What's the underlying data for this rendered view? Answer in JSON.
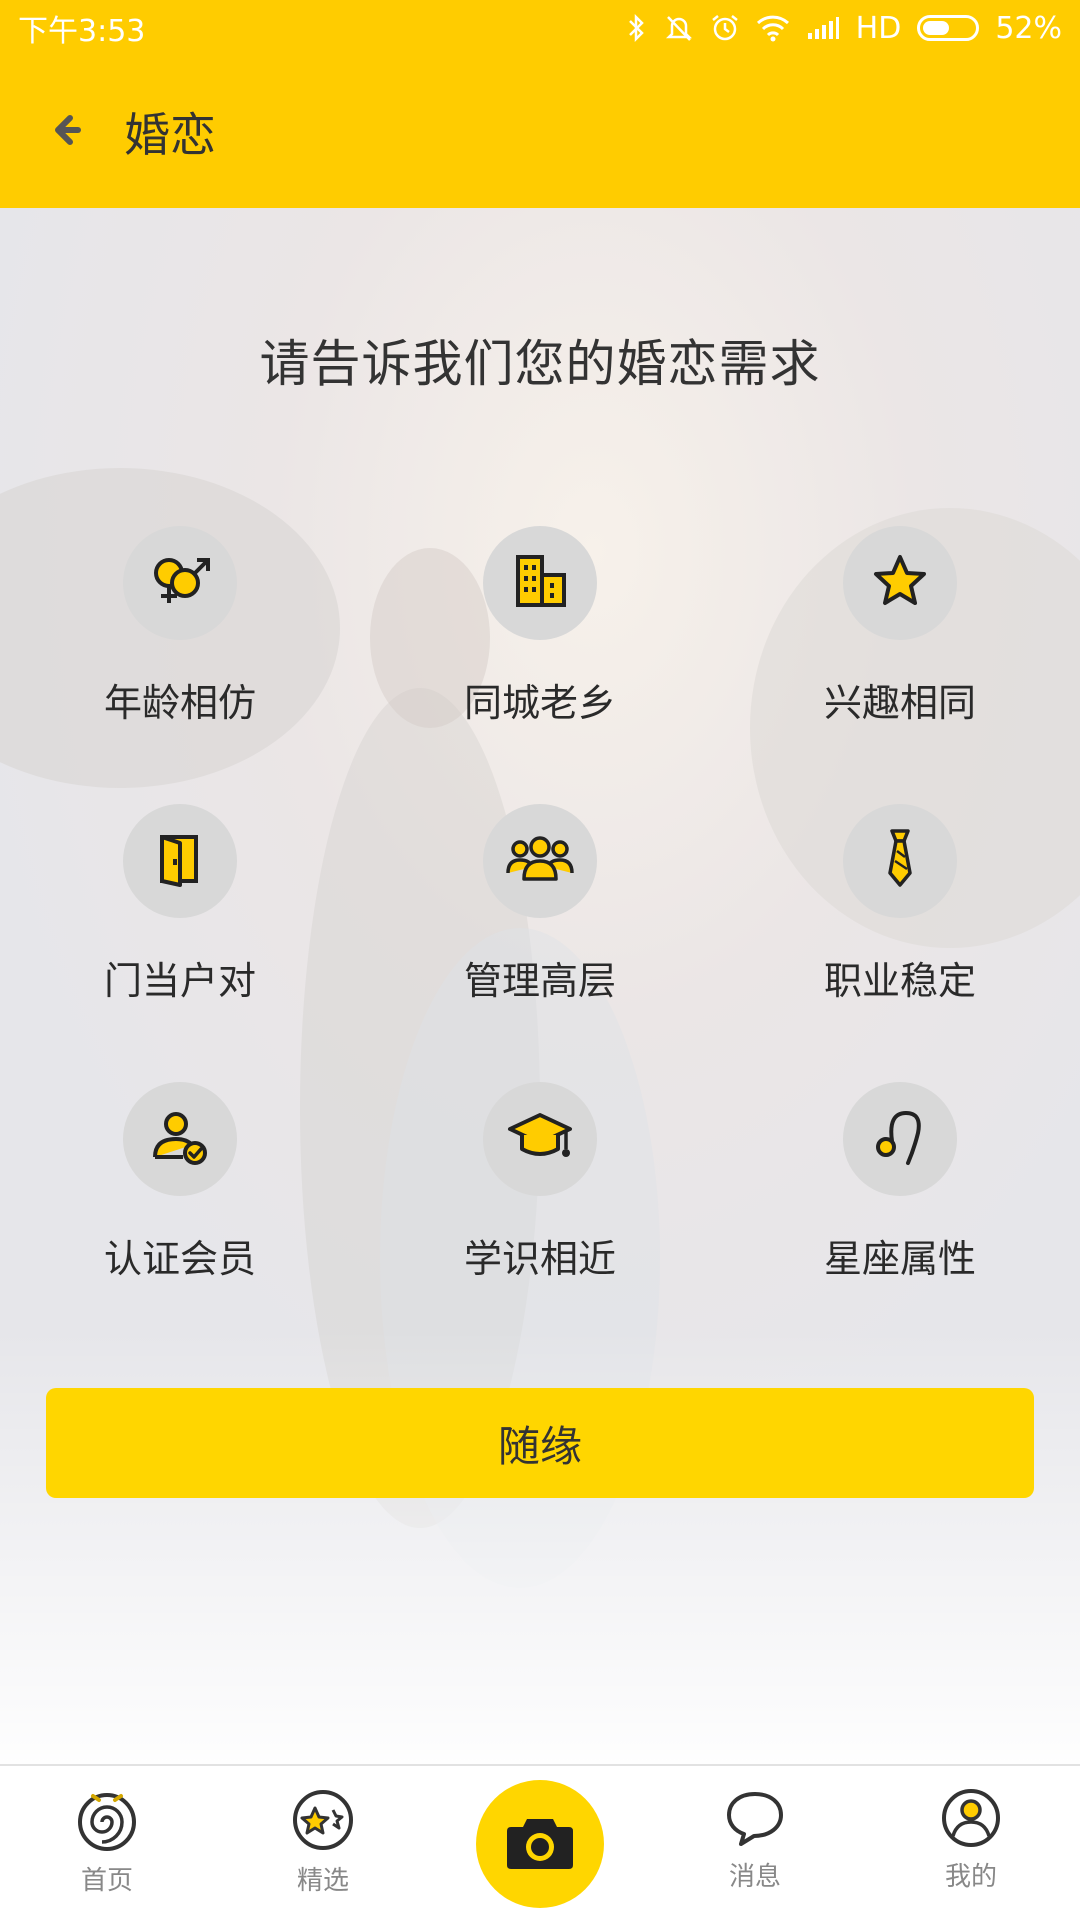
{
  "status_bar": {
    "time": "下午3:53",
    "network": "HD",
    "battery": "52%",
    "battery_level": 0.52,
    "icons": [
      "bluetooth-icon",
      "bell-off-icon",
      "alarm-icon",
      "wifi-icon",
      "signal-icon",
      "battery-icon"
    ]
  },
  "header": {
    "back_icon": "arrow-left-icon",
    "title": "婚恋"
  },
  "main": {
    "headline": "请告诉我们您的婚恋需求",
    "options": [
      {
        "label": "年龄相仿",
        "icon": "gender-symbols-icon"
      },
      {
        "label": "同城老乡",
        "icon": "buildings-icon"
      },
      {
        "label": "兴趣相同",
        "icon": "star-icon"
      },
      {
        "label": "门当户对",
        "icon": "door-icon"
      },
      {
        "label": "管理高层",
        "icon": "group-icon"
      },
      {
        "label": "职业稳定",
        "icon": "necktie-icon"
      },
      {
        "label": "认证会员",
        "icon": "verified-user-icon"
      },
      {
        "label": "学识相近",
        "icon": "graduation-cap-icon"
      },
      {
        "label": "星座属性",
        "icon": "zodiac-icon"
      }
    ],
    "random_button": "随缘"
  },
  "bottom_nav": {
    "items": [
      {
        "label": "首页",
        "icon": "home-spiral-icon"
      },
      {
        "label": "精选",
        "icon": "stars-icon"
      },
      {
        "label": "",
        "icon": "camera-icon"
      },
      {
        "label": "消息",
        "icon": "chat-bubble-icon"
      },
      {
        "label": "我的",
        "icon": "profile-icon"
      }
    ]
  },
  "colors": {
    "brand_yellow": "#ffcc00",
    "button_yellow": "#ffd600",
    "icon_circle": "#d8d8d8",
    "text_dark": "#333333",
    "nav_text": "#888888"
  }
}
